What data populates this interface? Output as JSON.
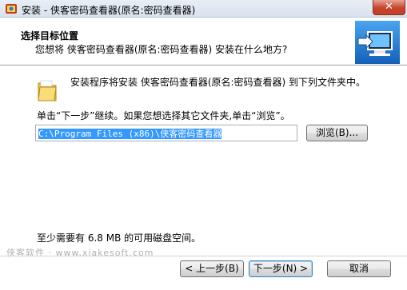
{
  "window": {
    "title": "安装 - 侠客密码查看器(原名:密码查看器)",
    "close_glyph": "✕"
  },
  "header": {
    "title": "选择目标位置",
    "subtitle": "您想将 侠客密码查看器(原名:密码查看器) 安装在什么地方?"
  },
  "body": {
    "install_text": "安装程序将安装 侠客密码查看器(原名:密码查看器) 到下列文件夹中。",
    "instruction": "单击“下一步”继续。如果您想选择其它文件夹,单击“浏览”。",
    "path_value": "C:\\Program Files (x86)\\侠客密码查看器",
    "browse_label": "浏览(B)...",
    "space_required": "至少需要有 6.8 MB 的可用磁盘空间。"
  },
  "footer": {
    "watermark": "侠客软件 · www.xiakesoft.com",
    "back_label": "< 上一步(B)",
    "next_label": "下一步(N) >",
    "cancel_label": "取消"
  },
  "colors": {
    "selection": "#3399ff",
    "close_button": "#c7432c",
    "title_bar": "#dfe7f1"
  }
}
